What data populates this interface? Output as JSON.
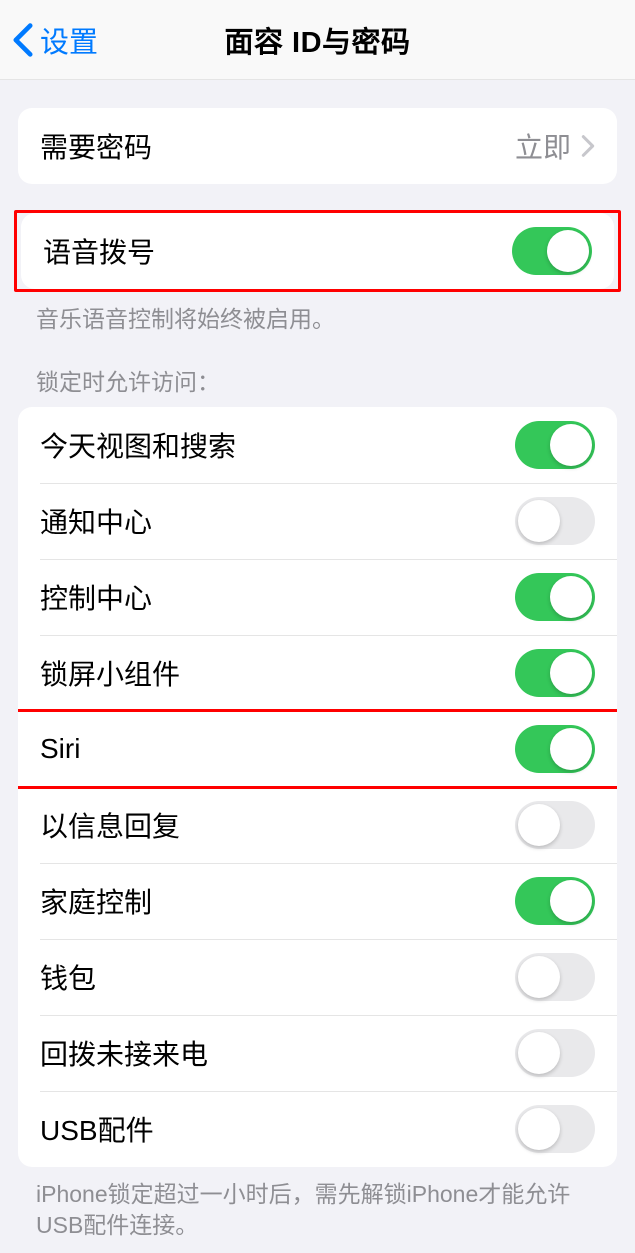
{
  "nav": {
    "back_label": "设置",
    "title": "面容 ID与密码"
  },
  "require_passcode": {
    "label": "需要密码",
    "value": "立即"
  },
  "voice_dial": {
    "label": "语音拨号",
    "on": true,
    "footer": "音乐语音控制将始终被启用。"
  },
  "lock_access": {
    "header": "锁定时允许访问：",
    "items": [
      {
        "label": "今天视图和搜索",
        "on": true
      },
      {
        "label": "通知中心",
        "on": false
      },
      {
        "label": "控制中心",
        "on": true
      },
      {
        "label": "锁屏小组件",
        "on": true
      },
      {
        "label": "Siri",
        "on": true,
        "highlight": true
      },
      {
        "label": "以信息回复",
        "on": false
      },
      {
        "label": "家庭控制",
        "on": true
      },
      {
        "label": "钱包",
        "on": false
      },
      {
        "label": "回拨未接来电",
        "on": false
      },
      {
        "label": "USB配件",
        "on": false
      }
    ],
    "footer": "iPhone锁定超过一小时后，需先解锁iPhone才能允许USB配件连接。"
  }
}
